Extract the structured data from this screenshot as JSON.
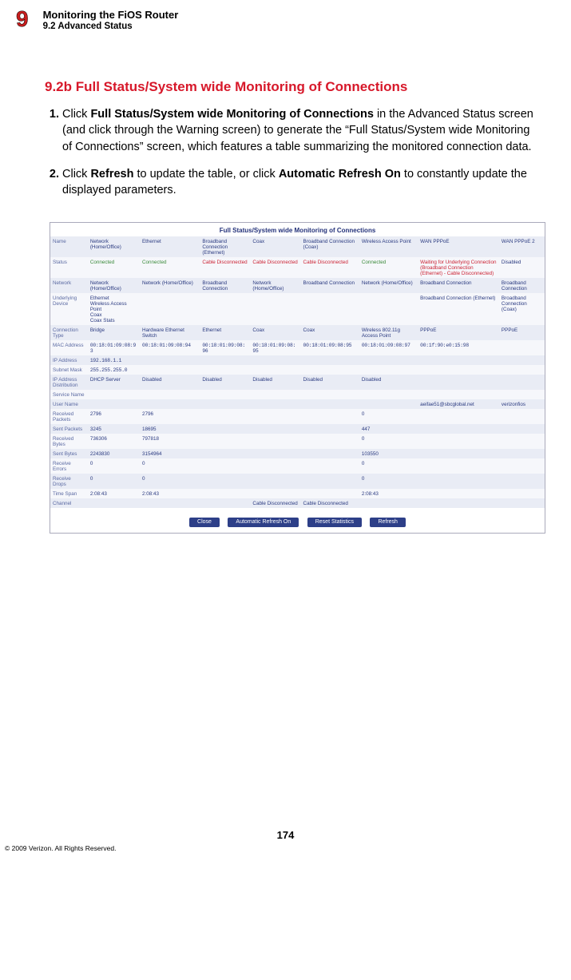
{
  "header": {
    "chapter_num": "9",
    "title": "Monitoring the FiOS Router",
    "sub": "9.2  Advanced Status"
  },
  "section_heading": "9.2b  Full Status/System wide Monitoring of Connections",
  "steps": {
    "s1_prefix": "Click ",
    "s1_bold1": "Full Status/System wide Monitoring of Connections",
    "s1_rest": " in the Advanced Status screen (and click through the Warning screen) to generate the “Full Status/System wide Monitoring of Connections” screen, which features a table summarizing the monitored connection data.",
    "s2_prefix": "Click ",
    "s2_bold1": "Refresh",
    "s2_mid": " to update the table, or click ",
    "s2_bold2": "Automatic Refresh On",
    "s2_rest": " to constantly update the displayed parameters."
  },
  "shot": {
    "title": "Full Status/System wide Monitoring of Connections",
    "cols": {
      "name": "Name",
      "c1": "Network (Home/Office)",
      "c2": "Ethernet",
      "c3": "Broadband Connection (Ethernet)",
      "c4": "Coax",
      "c5": "Broadband Connection (Coax)",
      "c6": "Wireless Access Point",
      "c7": "WAN PPPoE",
      "c8": "WAN PPPoE 2"
    },
    "rows": {
      "status": {
        "label": "Status",
        "c1": "Connected",
        "c2": "Connected",
        "c3": "Cable Disconnected",
        "c4": "Cable Disconnected",
        "c5": "Cable Disconnected",
        "c6": "Connected",
        "c7": "Waiting for Underlying Connection (Broadband Connection (Ethernet) - Cable Disconnected)",
        "c8": "Disabled"
      },
      "network": {
        "label": "Network",
        "c1": "Network (Home/Office)",
        "c2": "Network (Home/Office)",
        "c3": "Broadband Connection",
        "c4": "Network (Home/Office)",
        "c5": "Broadband Connection",
        "c6": "Network (Home/Office)",
        "c7": "Broadband Connection",
        "c8": "Broadband Connection"
      },
      "udev": {
        "label": "Underlying Device",
        "c1": "Ethernet\nWireless Access Point\nCoax\nCoax Stats",
        "c2": "",
        "c3": "",
        "c4": "",
        "c5": "",
        "c6": "",
        "c7": "Broadband Connection (Ethernet)",
        "c8": "Broadband Connection (Coax)"
      },
      "ctype": {
        "label": "Connection Type",
        "c1": "Bridge",
        "c2": "Hardware Ethernet Switch",
        "c3": "Ethernet",
        "c4": "Coax",
        "c5": "Coax",
        "c6": "Wireless 802.11g Access Point",
        "c7": "PPPoE",
        "c8": "PPPoE"
      },
      "mac": {
        "label": "MAC Address",
        "c1": "00:18:01:09:08:93",
        "c2": "00:18:01:09:08:94",
        "c3": "00:18:01:09:08:96",
        "c4": "00:18:01:09:08:95",
        "c5": "00:18:01:09:08:95",
        "c6": "00:18:01:09:08:97",
        "c7": "00:1f:90:e0:15:98",
        "c8": ""
      },
      "ip": {
        "label": "IP Address",
        "c1": "192.168.1.1",
        "c2": "",
        "c3": "",
        "c4": "",
        "c5": "",
        "c6": "",
        "c7": "",
        "c8": ""
      },
      "subnet": {
        "label": "Subnet Mask",
        "c1": "255.255.255.0",
        "c2": "",
        "c3": "",
        "c4": "",
        "c5": "",
        "c6": "",
        "c7": "",
        "c8": ""
      },
      "ipdist": {
        "label": "IP Address Distribution",
        "c1": "DHCP Server",
        "c2": "Disabled",
        "c3": "Disabled",
        "c4": "Disabled",
        "c5": "Disabled",
        "c6": "Disabled",
        "c7": "",
        "c8": ""
      },
      "svc": {
        "label": "Service Name",
        "c1": "",
        "c2": "",
        "c3": "",
        "c4": "",
        "c5": "",
        "c6": "",
        "c7": "",
        "c8": ""
      },
      "user": {
        "label": "User Name",
        "c1": "",
        "c2": "",
        "c3": "",
        "c4": "",
        "c5": "",
        "c6": "",
        "c7": "aeifae51@sbcglobal.net",
        "c8": "verizonfios"
      },
      "rpkts": {
        "label": "Received Packets",
        "c1": "2796",
        "c2": "2796",
        "c3": "",
        "c4": "",
        "c5": "",
        "c6": "0",
        "c7": "",
        "c8": ""
      },
      "spkts": {
        "label": "Sent Packets",
        "c1": "3245",
        "c2": "18695",
        "c3": "",
        "c4": "",
        "c5": "",
        "c6": "447",
        "c7": "",
        "c8": ""
      },
      "rbytes": {
        "label": "Received Bytes",
        "c1": "736306",
        "c2": "797818",
        "c3": "",
        "c4": "",
        "c5": "",
        "c6": "0",
        "c7": "",
        "c8": ""
      },
      "sbytes": {
        "label": "Sent Bytes",
        "c1": "2243830",
        "c2": "3154964",
        "c3": "",
        "c4": "",
        "c5": "",
        "c6": "103550",
        "c7": "",
        "c8": ""
      },
      "rerr": {
        "label": "Receive Errors",
        "c1": "0",
        "c2": "0",
        "c3": "",
        "c4": "",
        "c5": "",
        "c6": "0",
        "c7": "",
        "c8": ""
      },
      "rdrop": {
        "label": "Receive Drops",
        "c1": "0",
        "c2": "0",
        "c3": "",
        "c4": "",
        "c5": "",
        "c6": "0",
        "c7": "",
        "c8": ""
      },
      "tspan": {
        "label": "Time Span",
        "c1": "2:08:43",
        "c2": "2:08:43",
        "c3": "",
        "c4": "",
        "c5": "",
        "c6": "2:08:43",
        "c7": "",
        "c8": ""
      },
      "chan": {
        "label": "Channel",
        "c1": "",
        "c2": "",
        "c3": "",
        "c4": "Cable Disconnected",
        "c5": "Cable Disconnected",
        "c6": "",
        "c7": "",
        "c8": ""
      }
    },
    "buttons": {
      "close": "Close",
      "auto": "Automatic Refresh On",
      "reset": "Reset Statistics",
      "refresh": "Refresh"
    }
  },
  "pagenum": "174",
  "copyright": "© 2009 Verizon. All Rights Reserved."
}
